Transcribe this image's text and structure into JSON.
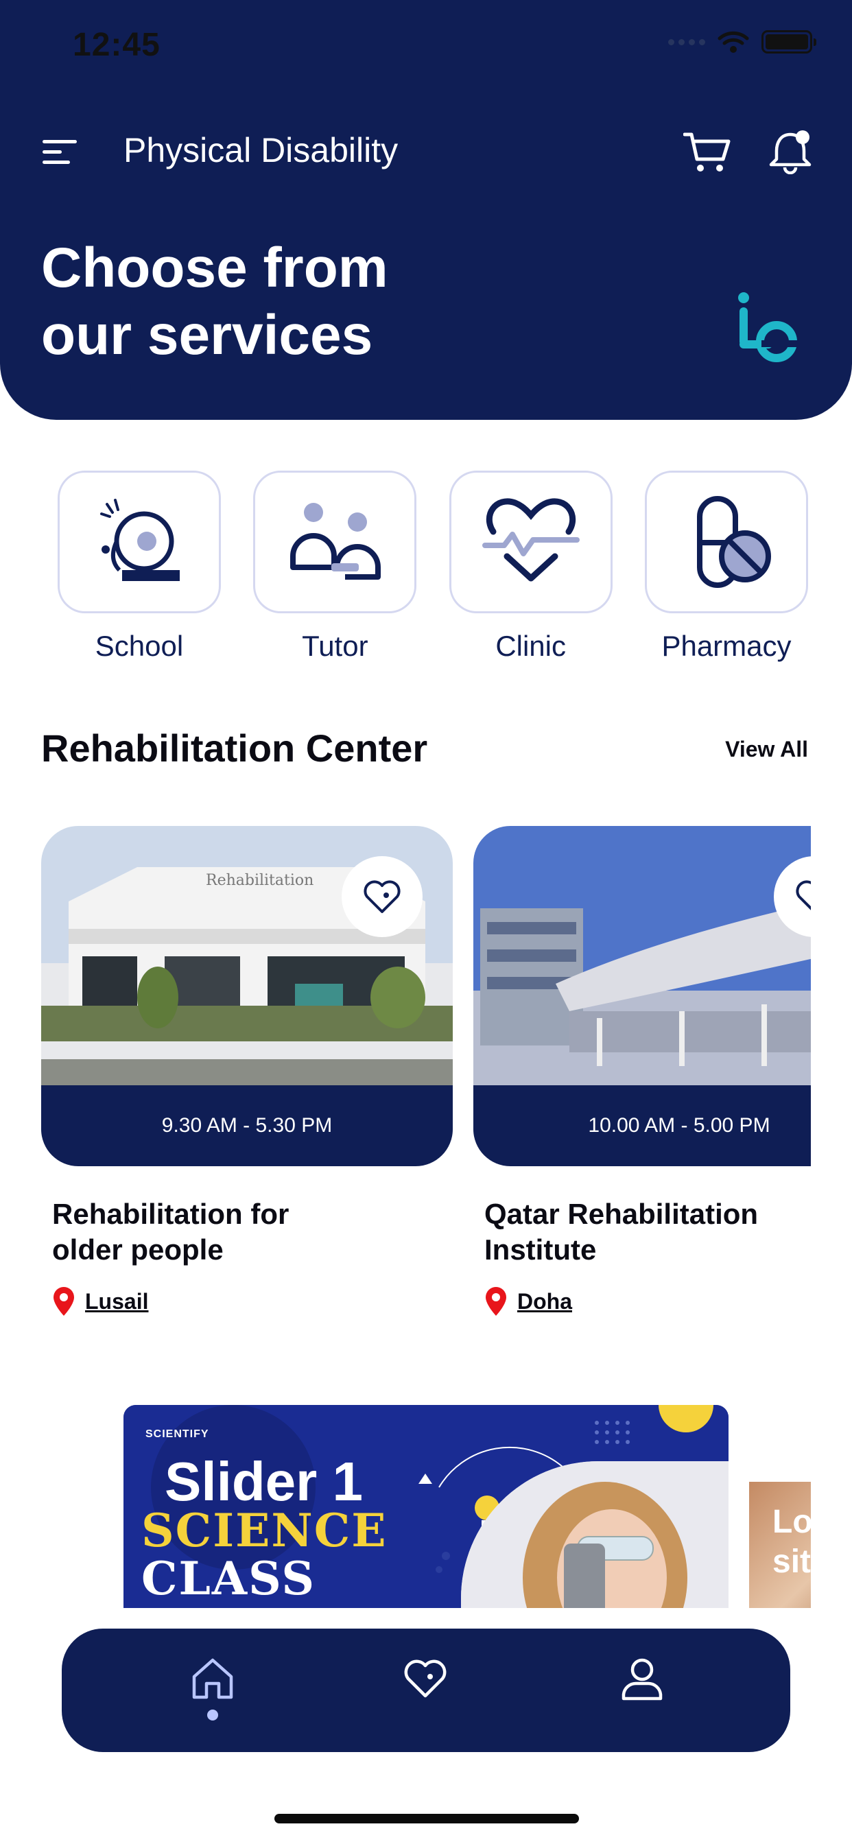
{
  "status_bar": {
    "time": "12:45"
  },
  "header": {
    "title": "Physical Disability",
    "menu_icon": "menu-icon",
    "cart_icon": "cart-icon",
    "bell_icon": "bell-icon",
    "background": "#0f1e55"
  },
  "hero": {
    "title": "Choose from\nour services"
  },
  "categories": [
    {
      "label": "School",
      "icon": "school-bell-icon"
    },
    {
      "label": "Tutor",
      "icon": "tutor-icon"
    },
    {
      "label": "Clinic",
      "icon": "clinic-heart-icon"
    },
    {
      "label": "Pharmacy",
      "icon": "pill-icon"
    }
  ],
  "section": {
    "title": "Rehabilitation Center",
    "view_all": "View All"
  },
  "centers": [
    {
      "hours": "9.30 AM - 5.30 PM",
      "name": "Rehabilitation for\nolder people",
      "location": "Lusail"
    },
    {
      "hours": "10.00 AM - 5.00 PM",
      "name": "Qatar Rehabilitation\nInstitute",
      "location": "Doha"
    }
  ],
  "banners": [
    {
      "brand": "SCIENTIFY",
      "slide_label": "Slider 1",
      "line1": "SCIENCE",
      "line2": "CLASS"
    },
    {
      "text": "Lo\nsit"
    }
  ],
  "bottom_nav": {
    "items": [
      "home",
      "favorites",
      "profile"
    ],
    "active": "home"
  },
  "colors": {
    "primary": "#0f1e55",
    "accent": "#1fb6c9",
    "tile_border": "#d5d8f0",
    "pin": "#e8151b"
  }
}
